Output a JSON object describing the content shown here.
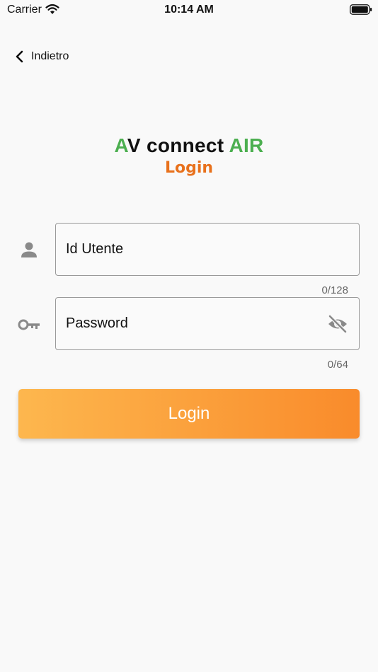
{
  "status_bar": {
    "carrier": "Carrier",
    "time": "10:14 AM"
  },
  "nav": {
    "back_label": "Indietro"
  },
  "title": {
    "part_a": "A",
    "part_v_connect": "V connect ",
    "part_air": "AIR",
    "subtitle": "Login"
  },
  "form": {
    "userid": {
      "placeholder": "Id Utente",
      "value": "",
      "counter": "0/128"
    },
    "password": {
      "placeholder": "Password",
      "value": "",
      "counter": "0/64"
    },
    "login_label": "Login"
  },
  "colors": {
    "title_green": "#4caf50",
    "subtitle_orange": "#e8711c",
    "button_gradient_start": "#fdb74e",
    "button_gradient_end": "#f98b2b"
  },
  "icons": {
    "field_user": "person-icon",
    "field_password": "key-icon",
    "toggle_visibility": "eye-off-icon",
    "back": "chevron-left-icon"
  }
}
